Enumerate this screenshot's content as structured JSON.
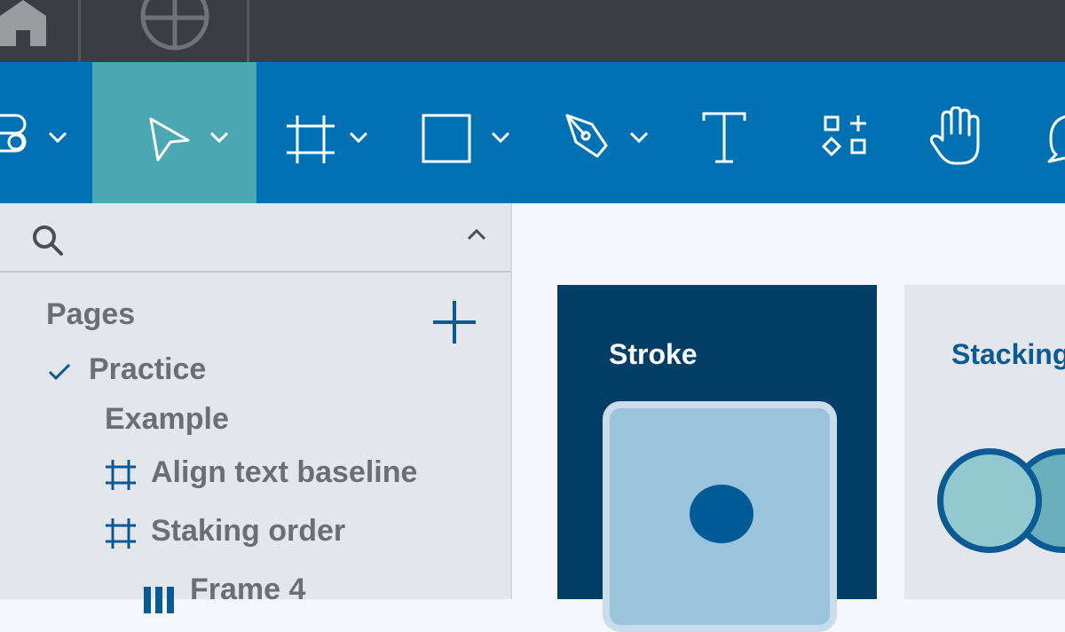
{
  "icons": {
    "home": "home-icon",
    "grid": "grid-globe-icon",
    "figma": "figma-logo-icon",
    "move": "move-cursor-icon",
    "frame": "frame-hash-icon",
    "shape": "rectangle-icon",
    "pen": "pen-icon",
    "text": "text-tool-icon",
    "resources": "resources-icon",
    "hand": "hand-icon",
    "comment": "comment-icon",
    "search": "search-icon",
    "collapse": "chevron-up-icon",
    "add_page": "plus-icon",
    "check": "checkmark-icon",
    "chevron": "chevron-down-icon"
  },
  "colors": {
    "topbar": "#3b3d42",
    "toolbar": "#0072b3",
    "active_tool": "#4ba8b2",
    "panel": "#e3e6ea",
    "canvas": "#f4f7fb",
    "card_dark": "#023e65",
    "accent": "#0a5a93"
  },
  "search": {
    "value": "",
    "placeholder": ""
  },
  "pages": {
    "title": "Pages",
    "items": [
      {
        "label": "Practice",
        "selected": true
      },
      {
        "label": "Example",
        "selected": false
      }
    ]
  },
  "layers": [
    {
      "label": "Align text baseline",
      "icon": "frame-hash-icon"
    },
    {
      "label": "Staking order",
      "icon": "frame-hash-icon"
    },
    {
      "label": "Frame 4",
      "icon": "columns-layout-icon"
    }
  ],
  "canvas": {
    "cards": [
      {
        "title": "Stroke"
      },
      {
        "title": "Stacking"
      }
    ]
  }
}
